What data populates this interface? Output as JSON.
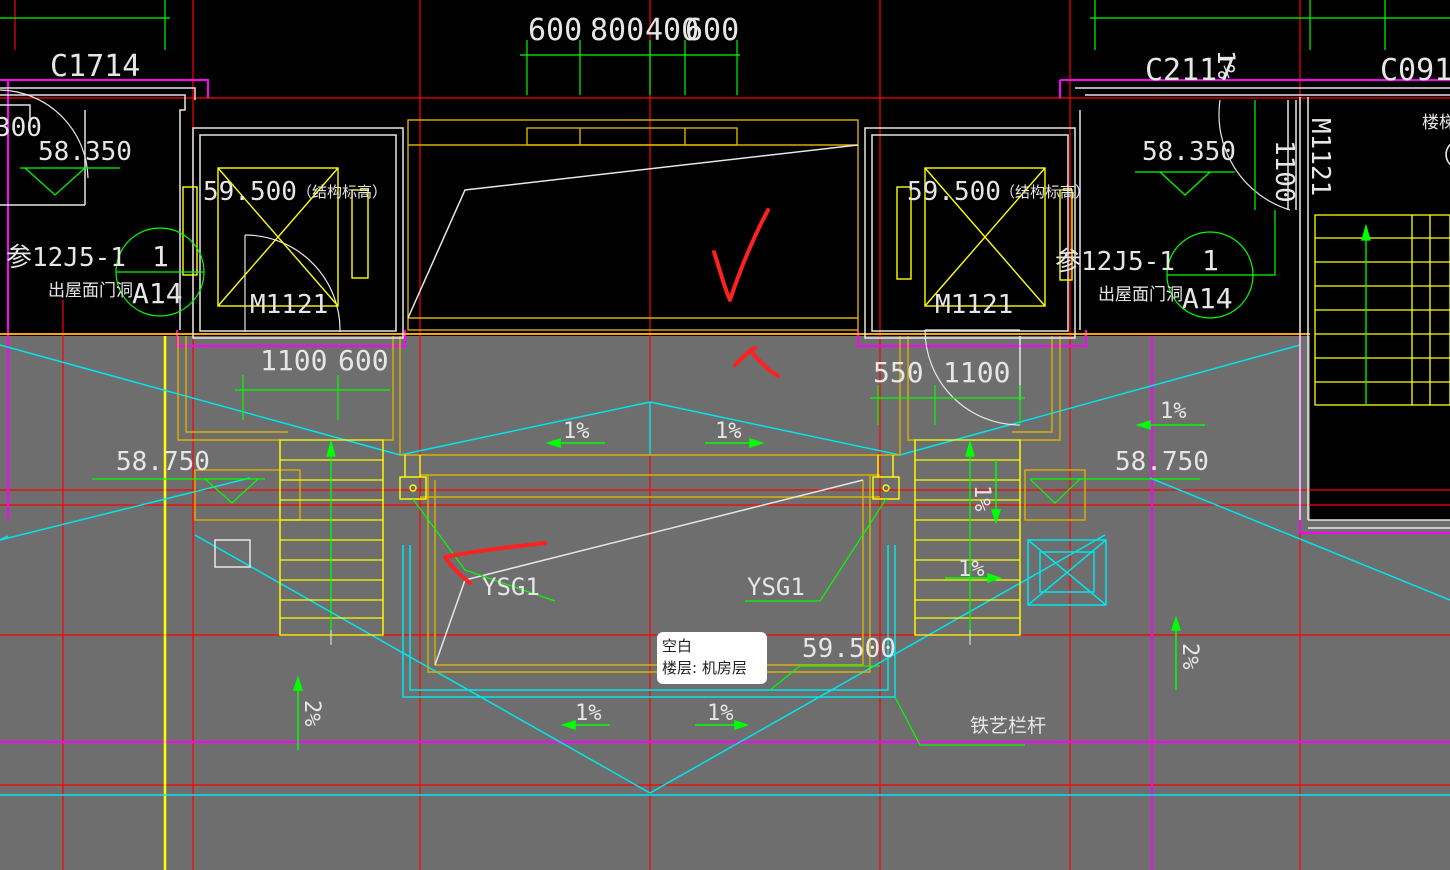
{
  "colors": {
    "background_top": "#000000",
    "background_floor": "#6e6e6e",
    "red_grid": "#ff0000",
    "magenta": "#ff00ff",
    "cyan": "#00e5ee",
    "yellow": "#ffff00",
    "green": "#00ff00",
    "white": "#e6e6e6",
    "orange": "#ffa500"
  },
  "labels": {
    "window_left": "C1714",
    "window_right_1": "C2117",
    "window_right_2": "C091",
    "dims_top": [
      "600",
      "800",
      "400",
      "600"
    ],
    "elev_58350_left": "58.350",
    "elev_58350_right": "58.350",
    "elev_59500_left": "59.500",
    "elev_59500_right": "59.500",
    "struct_note_left": "（结构标高）",
    "struct_note_right": "（结构标高）",
    "ref_left": "参12J5-1",
    "ref_right": "参12J5-1",
    "detail_num_left": "1",
    "detail_sheet_left": "A14",
    "detail_num_right": "1",
    "detail_sheet_right": "A14",
    "roof_hole_left": "出屋面门洞",
    "roof_hole_right": "出屋面门洞",
    "door_left": "M1121",
    "door_right": "M1121",
    "door_vertical": "M1121",
    "dim_1100_v": "1100",
    "dim_300": "300",
    "dim_1100_left": "1100",
    "dim_600_left": "600",
    "dim_550_right": "550",
    "dim_1100_right": "1100",
    "elev_58750_left": "58.750",
    "elev_58750_right": "58.750",
    "slope_1": "1%",
    "slope_2": "1%",
    "slope_3": "1%",
    "slope_4": "1%",
    "slope_5": "1%",
    "slope_6": "1%",
    "slope_7": "1%",
    "slope_8": "1%",
    "slope_2pct_left": "2%",
    "slope_2pct_right": "2%",
    "ysg_left": "YSG1",
    "ysg_right": "YSG1",
    "elev_59500_center": "59.500",
    "railing": "铁艺栏杆",
    "stair_note": "楼梯",
    "stair_bracket": "（1"
  },
  "tooltip": {
    "line1": "空白",
    "line2": "楼层: 机房层"
  }
}
